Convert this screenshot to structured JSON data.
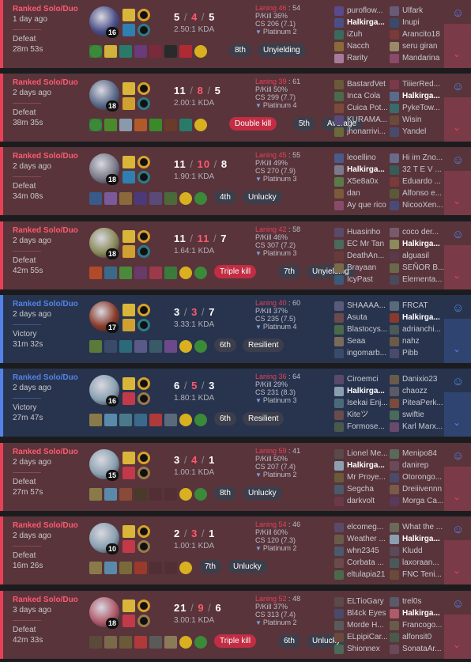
{
  "colors": {
    "defeat_bg": "#59343b",
    "victory_bg": "#28344e",
    "defeat_accent": "#e84057",
    "victory_accent": "#5383e8"
  },
  "icons": {
    "expand": "chevron-down-icon",
    "face": "face-search-icon",
    "tier": "tier-wing-icon"
  },
  "matches": [
    {
      "result_type": "defeat",
      "queue": "Ranked Solo/Duo",
      "ago": "1 day ago",
      "result": "Defeat",
      "length": "28m 53s",
      "champ_color": "#4a4f88",
      "level": "16",
      "spells": [
        "#d9b53a",
        "#2f7fb0"
      ],
      "runes": [
        "#d6a02b",
        "#2e7b86"
      ],
      "kills": "5",
      "deaths": "4",
      "assists": "5",
      "kda": "2.50:1 KDA",
      "laning_label": "Laning 46",
      "laning_opp": "54",
      "pkill": "P/Kill 36%",
      "cs": "CS 206 (7.1)",
      "tier": "Platinum 2",
      "items": [
        "#3b6e3a",
        "#d1b23a",
        "#2a7a6a",
        "#6a3a7a",
        "#7a2a3a",
        "#2a2a2a",
        "#b02a34",
        "#d8b020",
        "#3a8a3a"
      ],
      "tags": [
        {
          "text": "8th",
          "kill": false
        },
        {
          "text": "Unyielding",
          "kill": false
        }
      ],
      "team1": [
        {
          "name": "puroflow...",
          "c": "#5a4a8a"
        },
        {
          "name": "Halkirga...",
          "c": "#4a4f88"
        },
        {
          "name": "iZuh",
          "c": "#3a6a5a"
        },
        {
          "name": "Nacch",
          "c": "#8a6a3a"
        },
        {
          "name": "Rarity",
          "c": "#aa7a9a"
        }
      ],
      "team2": [
        {
          "name": "Ulfark",
          "c": "#6a5a7a"
        },
        {
          "name": "Inupi",
          "c": "#3a4a6a"
        },
        {
          "name": "Arancito18",
          "c": "#7a3a3a"
        },
        {
          "name": "seru giran",
          "c": "#9a8a6a"
        },
        {
          "name": "Mandarina",
          "c": "#8a4a6a"
        }
      ],
      "me1": 1,
      "me2": -1
    },
    {
      "result_type": "defeat",
      "queue": "Ranked Solo/Duo",
      "ago": "2 days ago",
      "result": "Defeat",
      "length": "38m 35s",
      "champ_color": "#5a6a8a",
      "level": "18",
      "spells": [
        "#d9b53a",
        "#d0a030"
      ],
      "runes": [
        "#d6a02b",
        "#2e7b86"
      ],
      "kills": "11",
      "deaths": "8",
      "assists": "5",
      "kda": "2.00:1 KDA",
      "laning_label": "Laning 39",
      "laning_opp": "61",
      "pkill": "P/Kill 50%",
      "cs": "CS 299 (7.7)",
      "tier": "Platinum 4",
      "items": [
        "#3a6a3a",
        "#4a8a2a",
        "#8a9aaa",
        "#b05a2a",
        "#3a8a2a",
        "#6a3a2a",
        "#2a7a6a",
        "#d8b020",
        "#3a8a3a"
      ],
      "tags": [
        {
          "text": "Double kill",
          "kill": true
        },
        {
          "text": "5th",
          "kill": false
        },
        {
          "text": "Average",
          "kill": false
        }
      ],
      "team1": [
        {
          "name": "BastardVet",
          "c": "#6a5a3a"
        },
        {
          "name": "Inca Cola",
          "c": "#4a6a4a"
        },
        {
          "name": "Cuica Pot...",
          "c": "#7a4a3a"
        },
        {
          "name": "KURAMA...",
          "c": "#5a4a7a"
        },
        {
          "name": "jhonarrivi...",
          "c": "#6a6a3a"
        }
      ],
      "team2": [
        {
          "name": "TiiierRed...",
          "c": "#7a3a4a"
        },
        {
          "name": "Halkirga...",
          "c": "#5a6a8a"
        },
        {
          "name": "PykeTow...",
          "c": "#3a6a6a"
        },
        {
          "name": "Wisin",
          "c": "#6a4a3a"
        },
        {
          "name": "Yandel",
          "c": "#4a4a6a"
        }
      ],
      "me1": -1,
      "me2": 1
    },
    {
      "result_type": "defeat",
      "queue": "Ranked Solo/Duo",
      "ago": "2 days ago",
      "result": "Defeat",
      "length": "34m 08s",
      "champ_color": "#7a7a8a",
      "level": "18",
      "spells": [
        "#d9b53a",
        "#2f7fb0"
      ],
      "runes": [
        "#d6a02b",
        "#2e7b86"
      ],
      "kills": "11",
      "deaths": "10",
      "assists": "8",
      "kda": "1.90:1 KDA",
      "laning_label": "Laning 45",
      "laning_opp": "55",
      "pkill": "P/Kill 49%",
      "cs": "CS 270 (7.9)",
      "tier": "Platinum 3",
      "items": [
        "#3a5a8a",
        "#7a5a9a",
        "#8a6a3a",
        "#4a3a7a",
        "#5a4a7a",
        "#4a6a3a",
        "#d8b020",
        "#3a8a3a"
      ],
      "tags": [
        {
          "text": "4th",
          "kill": false
        },
        {
          "text": "Unlucky",
          "kill": false
        }
      ],
      "team1": [
        {
          "name": "leoellino",
          "c": "#4a5a8a"
        },
        {
          "name": "Halkirga...",
          "c": "#7a7a8a"
        },
        {
          "name": "X5e8a0x",
          "c": "#5a7a4a"
        },
        {
          "name": "dan",
          "c": "#7a5a3a"
        },
        {
          "name": "Ay que rico",
          "c": "#8a4a6a"
        }
      ],
      "team2": [
        {
          "name": "Hi im Zno...",
          "c": "#6a6a8a"
        },
        {
          "name": "32 T E V ...",
          "c": "#3a5a5a"
        },
        {
          "name": "Eduardo ...",
          "c": "#7a3a3a"
        },
        {
          "name": "Alfonso e...",
          "c": "#5a5a3a"
        },
        {
          "name": "NicooXen...",
          "c": "#4a4a7a"
        }
      ],
      "me1": 1,
      "me2": -1
    },
    {
      "result_type": "defeat",
      "queue": "Ranked Solo/Duo",
      "ago": "2 days ago",
      "result": "Defeat",
      "length": "42m 55s",
      "champ_color": "#8a8a5a",
      "level": "18",
      "spells": [
        "#d9b53a",
        "#d0a030"
      ],
      "runes": [
        "#d6a02b",
        "#2e7b86"
      ],
      "kills": "11",
      "deaths": "11",
      "assists": "7",
      "kda": "1.64:1 KDA",
      "laning_label": "Laning 42",
      "laning_opp": "58",
      "pkill": "P/Kill 46%",
      "cs": "CS 307 (7.2)",
      "tier": "Platinum 3",
      "items": [
        "#b04a2a",
        "#3a6a8a",
        "#4a8a3a",
        "#6a3a6a",
        "#9a3a4a",
        "#3a7a3a",
        "#d8b020",
        "#3a8a3a"
      ],
      "tags": [
        {
          "text": "Triple kill",
          "kill": true
        },
        {
          "text": "7th",
          "kill": false
        },
        {
          "text": "Unyielding",
          "kill": false
        }
      ],
      "team1": [
        {
          "name": "Huasinho",
          "c": "#5a4a6a"
        },
        {
          "name": "EC Mr Tan",
          "c": "#4a6a5a"
        },
        {
          "name": "DeathAn...",
          "c": "#6a3a3a"
        },
        {
          "name": "Brayaan",
          "c": "#7a6a4a"
        },
        {
          "name": "IcyPast",
          "c": "#3a5a7a"
        }
      ],
      "team2": [
        {
          "name": "coco der...",
          "c": "#7a5a6a"
        },
        {
          "name": "Halkirga...",
          "c": "#8a8a5a"
        },
        {
          "name": "alguasil",
          "c": "#5a3a4a"
        },
        {
          "name": "SEÑOR B...",
          "c": "#6a6a4a"
        },
        {
          "name": "Elementa...",
          "c": "#4a4a5a"
        }
      ],
      "me1": -1,
      "me2": 1
    },
    {
      "result_type": "victory",
      "queue": "Ranked Solo/Duo",
      "ago": "2 days ago",
      "result": "Victory",
      "length": "31m 32s",
      "champ_color": "#8a3a2a",
      "level": "17",
      "spells": [
        "#d9b53a",
        "#d0a030"
      ],
      "runes": [
        "#d6a02b",
        "#2e7b86"
      ],
      "kills": "3",
      "deaths": "3",
      "assists": "7",
      "kda": "3.33:1 KDA",
      "laning_label": "Laning 40",
      "laning_opp": "60",
      "pkill": "P/Kill 37%",
      "cs": "CS 235 (7.5)",
      "tier": "Platinum 4",
      "items": [
        "#5a7a3a",
        "#3a4a6a",
        "#2a6a7a",
        "#5a5a8a",
        "#3a5a6a",
        "#6a4a8a",
        "#d8b020",
        "#3a8a3a"
      ],
      "tags": [
        {
          "text": "6th",
          "kill": false
        },
        {
          "text": "Resilient",
          "kill": false
        }
      ],
      "team1": [
        {
          "name": "SHAAAA...",
          "c": "#5a5a7a"
        },
        {
          "name": "Asuta",
          "c": "#6a4a4a"
        },
        {
          "name": "Blastocys...",
          "c": "#4a6a4a"
        },
        {
          "name": "Seaa",
          "c": "#7a6a5a"
        },
        {
          "name": "ingomarb...",
          "c": "#3a4a6a"
        }
      ],
      "team2": [
        {
          "name": "FRCAT",
          "c": "#5a6a7a"
        },
        {
          "name": "Halkirga...",
          "c": "#8a3a2a"
        },
        {
          "name": "adrianchi...",
          "c": "#4a5a5a"
        },
        {
          "name": "nahz",
          "c": "#6a5a4a"
        },
        {
          "name": "Pibb",
          "c": "#4a4a6a"
        }
      ],
      "me1": -1,
      "me2": 1
    },
    {
      "result_type": "victory",
      "queue": "Ranked Solo/Duo",
      "ago": "2 days ago",
      "result": "Victory",
      "length": "27m 47s",
      "champ_color": "#8aa0b0",
      "level": "16",
      "spells": [
        "#d9b53a",
        "#c23a4a"
      ],
      "runes": [
        "#d6a02b",
        "#9a7a4a"
      ],
      "kills": "6",
      "deaths": "5",
      "assists": "3",
      "kda": "1.80:1 KDA",
      "laning_label": "Laning 36",
      "laning_opp": "64",
      "pkill": "P/Kill 29%",
      "cs": "CS 231 (8.3)",
      "tier": "Platinum 3",
      "items": [
        "#8a7a4a",
        "#5a8aaa",
        "#4a7a8a",
        "#3a6a8a",
        "#b03a3a",
        "#5a6a7a",
        "#d8b020",
        "#3a8a3a"
      ],
      "tags": [
        {
          "text": "6th",
          "kill": false
        },
        {
          "text": "Resilient",
          "kill": false
        }
      ],
      "team1": [
        {
          "name": "Ciroemci",
          "c": "#5a4a6a"
        },
        {
          "name": "Halkirga...",
          "c": "#8aa0b0"
        },
        {
          "name": "Isekai Enj...",
          "c": "#4a6a7a"
        },
        {
          "name": "Kiteツ",
          "c": "#6a4a4a"
        },
        {
          "name": "Formose...",
          "c": "#4a5a4a"
        }
      ],
      "team2": [
        {
          "name": "Danixio23",
          "c": "#6a5a4a"
        },
        {
          "name": "chaozz",
          "c": "#5a5a6a"
        },
        {
          "name": "PiteaPerk...",
          "c": "#7a4a3a"
        },
        {
          "name": "swiftie",
          "c": "#4a6a5a"
        },
        {
          "name": "Karl Marx...",
          "c": "#6a4a6a"
        }
      ],
      "me1": 1,
      "me2": -1
    },
    {
      "result_type": "defeat",
      "queue": "Ranked Solo/Duo",
      "ago": "2 days ago",
      "result": "Defeat",
      "length": "27m 57s",
      "champ_color": "#8aa0b0",
      "level": "15",
      "spells": [
        "#d9b53a",
        "#c23a4a"
      ],
      "runes": [
        "#d6a02b",
        "#9a7a4a"
      ],
      "kills": "3",
      "deaths": "4",
      "assists": "1",
      "kda": "1.00:1 KDA",
      "laning_label": "Laning 59",
      "laning_opp": "41",
      "pkill": "P/Kill 50%",
      "cs": "CS 207 (7.4)",
      "tier": "Platinum 2",
      "items": [
        "#8a7a4a",
        "#5a8aaa",
        "#8a4a3a",
        "#4a3a2a",
        "",
        "",
        "#d8b020",
        "#3a8a3a"
      ],
      "tags": [
        {
          "text": "8th",
          "kill": false
        },
        {
          "text": "Unlucky",
          "kill": false
        }
      ],
      "team1": [
        {
          "name": "Lionel Me...",
          "c": "#5a4a4a"
        },
        {
          "name": "Halkirga...",
          "c": "#8aa0b0"
        },
        {
          "name": "Mr Proye...",
          "c": "#6a5a3a"
        },
        {
          "name": "Segcha",
          "c": "#4a5a6a"
        },
        {
          "name": "darkvolt",
          "c": "#6a3a4a"
        }
      ],
      "team2": [
        {
          "name": "Menipo84",
          "c": "#5a6a5a"
        },
        {
          "name": "danirep",
          "c": "#6a4a5a"
        },
        {
          "name": "Otorongo...",
          "c": "#4a4a6a"
        },
        {
          "name": "Dreiiivennn",
          "c": "#7a5a4a"
        },
        {
          "name": "Morga Ca...",
          "c": "#5a3a5a"
        }
      ],
      "me1": 1,
      "me2": -1
    },
    {
      "result_type": "defeat",
      "queue": "Ranked Solo/Duo",
      "ago": "2 days ago",
      "result": "Defeat",
      "length": "16m 26s",
      "champ_color": "#8aa0b0",
      "level": "10",
      "spells": [
        "#d9b53a",
        "#c23a4a"
      ],
      "runes": [
        "#d6a02b",
        "#9a7a4a"
      ],
      "kills": "2",
      "deaths": "3",
      "assists": "1",
      "kda": "1.00:1 KDA",
      "laning_label": "Laning 54",
      "laning_opp": "46",
      "pkill": "P/Kill 60%",
      "cs": "CS 120 (7.3)",
      "tier": "Platinum 2",
      "items": [
        "#8a7a4a",
        "#5a8aaa",
        "#7a6a3a",
        "#9a3a2a",
        "",
        "",
        "#d8b020"
      ],
      "tags": [
        {
          "text": "7th",
          "kill": false
        },
        {
          "text": "Unlucky",
          "kill": false
        }
      ],
      "team1": [
        {
          "name": "elcomeg...",
          "c": "#5a4a6a"
        },
        {
          "name": "Weather ...",
          "c": "#6a5a4a"
        },
        {
          "name": "whn2345",
          "c": "#4a5a6a"
        },
        {
          "name": "Corbata ...",
          "c": "#6a4a4a"
        },
        {
          "name": "eltulapia21",
          "c": "#4a6a4a"
        }
      ],
      "team2": [
        {
          "name": "What the ...",
          "c": "#6a6a5a"
        },
        {
          "name": "Halkirga...",
          "c": "#8aa0b0"
        },
        {
          "name": "Kludd",
          "c": "#5a4a5a"
        },
        {
          "name": "laxoraan...",
          "c": "#4a5a5a"
        },
        {
          "name": "FNC Teni...",
          "c": "#6a4a3a"
        }
      ],
      "me1": -1,
      "me2": 1
    },
    {
      "result_type": "defeat",
      "queue": "Ranked Solo/Duo",
      "ago": "3 days ago",
      "result": "Defeat",
      "length": "42m 33s",
      "champ_color": "#b05a6a",
      "level": "18",
      "spells": [
        "#d9b53a",
        "#c23a4a"
      ],
      "runes": [
        "#d6a02b",
        "#9a7a4a"
      ],
      "kills": "21",
      "deaths": "9",
      "assists": "6",
      "kda": "3.00:1 KDA",
      "laning_label": "Laning 52",
      "laning_opp": "48",
      "pkill": "P/Kill 37%",
      "cs": "CS 313 (7.4)",
      "tier": "Platinum 2",
      "items": [
        "#5a4a3a",
        "#7a6a4a",
        "#6a5a3a",
        "#b03a3a",
        "#5a5a5a",
        "#8a7a5a",
        "#d8b020",
        "#3a8a3a"
      ],
      "tags": [
        {
          "text": "Triple kill",
          "kill": true
        },
        {
          "text": "6th",
          "kill": false
        },
        {
          "text": "Unlucky",
          "kill": false
        }
      ],
      "team1": [
        {
          "name": "ELTioGary",
          "c": "#5a4a4a"
        },
        {
          "name": "Bl4ck Eyes",
          "c": "#4a4a6a"
        },
        {
          "name": "Morde H...",
          "c": "#5a5a5a"
        },
        {
          "name": "ELpipiCar...",
          "c": "#6a4a3a"
        },
        {
          "name": "Shionnex",
          "c": "#4a6a5a"
        }
      ],
      "team2": [
        {
          "name": "trel0s",
          "c": "#5a5a6a"
        },
        {
          "name": "Halkirga...",
          "c": "#b05a6a"
        },
        {
          "name": "Francogo...",
          "c": "#6a5a4a"
        },
        {
          "name": "alfonsit0",
          "c": "#4a5a4a"
        },
        {
          "name": "SonataAr...",
          "c": "#6a4a5a"
        }
      ],
      "me1": -1,
      "me2": 1
    }
  ]
}
